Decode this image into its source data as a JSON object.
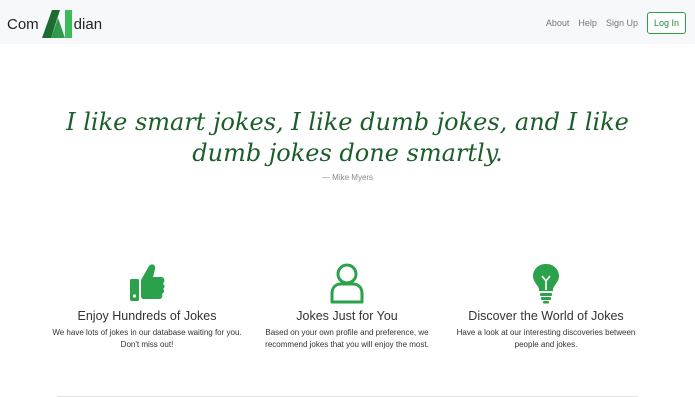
{
  "brand": {
    "prefix": "Com",
    "suffix": "dian"
  },
  "nav": {
    "about": "About",
    "help": "Help",
    "signup": "Sign Up",
    "login": "Log In"
  },
  "quote": {
    "text": "I like smart jokes, I like dumb jokes, and I like dumb jokes done smartly.",
    "author": "— Mike Myers"
  },
  "features": [
    {
      "icon": "thumbs-up-icon",
      "title": "Enjoy Hundreds of Jokes",
      "desc": "We have lots of jokes in our database waiting for you. Don't miss out!"
    },
    {
      "icon": "user-icon",
      "title": "Jokes Just for You",
      "desc": "Based on your own profile and preference, we recommend jokes that you will enjoy the most."
    },
    {
      "icon": "lightbulb-icon",
      "title": "Discover the World of Jokes",
      "desc": "Have a look at our interesting discoveries between people and jokes."
    }
  ],
  "colors": {
    "accent": "#2aa14a",
    "quote": "#1b5e2b",
    "logo_dark": "#1e6b32",
    "logo_light": "#3dbb5a"
  }
}
